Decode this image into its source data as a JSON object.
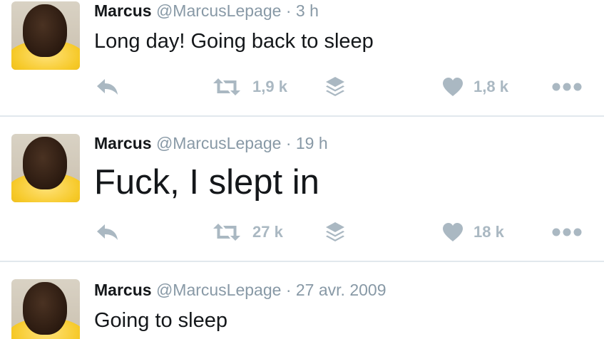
{
  "tweets": [
    {
      "name": "Marcus",
      "handle": "@MarcusLepage",
      "separator": "·",
      "time": "3 h",
      "text": "Long day! Going back to sleep",
      "retweets": "1,9 k",
      "likes": "1,8 k"
    },
    {
      "name": "Marcus",
      "handle": "@MarcusLepage",
      "separator": "·",
      "time": "19 h",
      "text": "Fuck, I slept in",
      "retweets": "27 k",
      "likes": "18 k"
    },
    {
      "name": "Marcus",
      "handle": "@MarcusLepage",
      "separator": "·",
      "time": "27 avr. 2009",
      "text": "Going to sleep"
    }
  ],
  "icons": {
    "reply": "reply-arrow-icon",
    "retweet": "retweet-icon",
    "stack": "layers-icon",
    "like": "heart-icon",
    "more": "more-dots-icon"
  },
  "colors": {
    "text": "#14171a",
    "secondary": "#8899a6",
    "action": "#aab8c2",
    "divider": "#e1e8ed"
  }
}
